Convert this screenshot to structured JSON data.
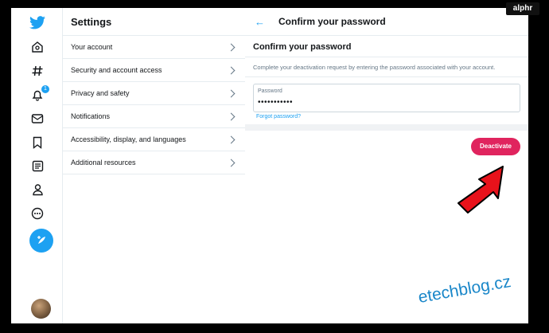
{
  "nav": {
    "icons": [
      "twitter-bird-icon",
      "home-icon",
      "hashtag-icon",
      "bell-icon",
      "mail-icon",
      "bookmark-icon",
      "list-icon",
      "profile-icon",
      "more-icon"
    ],
    "notification_count": "1",
    "accent": "#1da1f2"
  },
  "settings": {
    "title": "Settings",
    "items": [
      {
        "label": "Your account"
      },
      {
        "label": "Security and account access"
      },
      {
        "label": "Privacy and safety"
      },
      {
        "label": "Notifications"
      },
      {
        "label": "Accessibility, display, and languages"
      },
      {
        "label": "Additional resources"
      }
    ]
  },
  "main": {
    "header_title": "Confirm your password",
    "section_title": "Confirm your password",
    "description": "Complete your deactivation request by entering the password associated with your account.",
    "password_label": "Password",
    "password_value": "•••••••••••",
    "forgot_link": "Forgot password?",
    "deactivate_label": "Deactivate",
    "deactivate_color": "#e0245e"
  },
  "watermarks": {
    "top": "alphr",
    "bottom": "etechblog.cz"
  }
}
